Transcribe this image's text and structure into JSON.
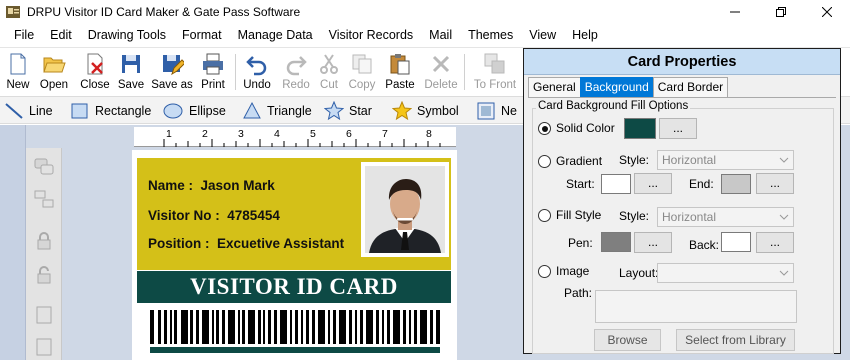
{
  "window": {
    "title": "DRPU Visitor ID Card Maker & Gate Pass Software"
  },
  "menu": [
    "File",
    "Edit",
    "Drawing Tools",
    "Format",
    "Manage Data",
    "Visitor Records",
    "Mail",
    "Themes",
    "View",
    "Help"
  ],
  "toolbar": [
    {
      "label": "New",
      "icon": "new-file-icon",
      "enabled": true
    },
    {
      "label": "Open",
      "icon": "open-folder-icon",
      "enabled": true
    },
    {
      "label": "Close",
      "icon": "close-file-icon",
      "enabled": true
    },
    {
      "label": "Save",
      "icon": "save-icon",
      "enabled": true
    },
    {
      "label": "Save as",
      "icon": "save-as-icon",
      "enabled": true
    },
    {
      "label": "Print",
      "icon": "print-icon",
      "enabled": true
    },
    {
      "label": "Undo",
      "icon": "undo-icon",
      "enabled": true
    },
    {
      "label": "Redo",
      "icon": "redo-icon",
      "enabled": false
    },
    {
      "label": "Cut",
      "icon": "cut-icon",
      "enabled": false
    },
    {
      "label": "Copy",
      "icon": "copy-icon",
      "enabled": false
    },
    {
      "label": "Paste",
      "icon": "paste-icon",
      "enabled": true
    },
    {
      "label": "Delete",
      "icon": "delete-icon",
      "enabled": false
    },
    {
      "label": "To Front",
      "icon": "to-front-icon",
      "enabled": false
    }
  ],
  "drawing_tools": [
    {
      "label": "Line",
      "icon": "line-icon"
    },
    {
      "label": "Rectangle",
      "icon": "rectangle-icon"
    },
    {
      "label": "Ellipse",
      "icon": "ellipse-icon"
    },
    {
      "label": "Triangle",
      "icon": "triangle-icon"
    },
    {
      "label": "Star",
      "icon": "star-icon"
    },
    {
      "label": "Symbol",
      "icon": "symbol-icon"
    },
    {
      "label": "Ne",
      "icon": "new-image-icon"
    }
  ],
  "ruler": {
    "numbers": [
      "1",
      "2",
      "3",
      "4",
      "5",
      "6",
      "7",
      "8"
    ]
  },
  "card": {
    "name_label": "Name :",
    "name_value": "Jason Mark",
    "visitor_no_label": "Visitor No :",
    "visitor_no_value": "4785454",
    "position_label": "Position :",
    "position_value": "Excuetive Assistant",
    "banner": "VISITOR ID CARD",
    "colors": {
      "top": "#d4c018",
      "band": "#0d4a45"
    }
  },
  "properties": {
    "title": "Card Properties",
    "tabs": [
      "General",
      "Background",
      "Card Border"
    ],
    "active_tab": "Background",
    "group_title": "Card Background Fill Options",
    "solid_color": {
      "label": "Solid Color",
      "selected": true,
      "color": "#0d4a45",
      "button": "..."
    },
    "gradient": {
      "label": "Gradient",
      "style_label": "Style:",
      "style_value": "Horizontal",
      "start_label": "Start:",
      "end_label": "End:",
      "button": "..."
    },
    "fill_style": {
      "label": "Fill Style",
      "style_label": "Style:",
      "style_value": "Horizontal",
      "pen_label": "Pen:",
      "back_label": "Back:",
      "button": "..."
    },
    "image": {
      "label": "Image",
      "layout_label": "Layout:",
      "path_label": "Path:"
    },
    "browse_button": "Browse",
    "library_button": "Select from Library"
  }
}
